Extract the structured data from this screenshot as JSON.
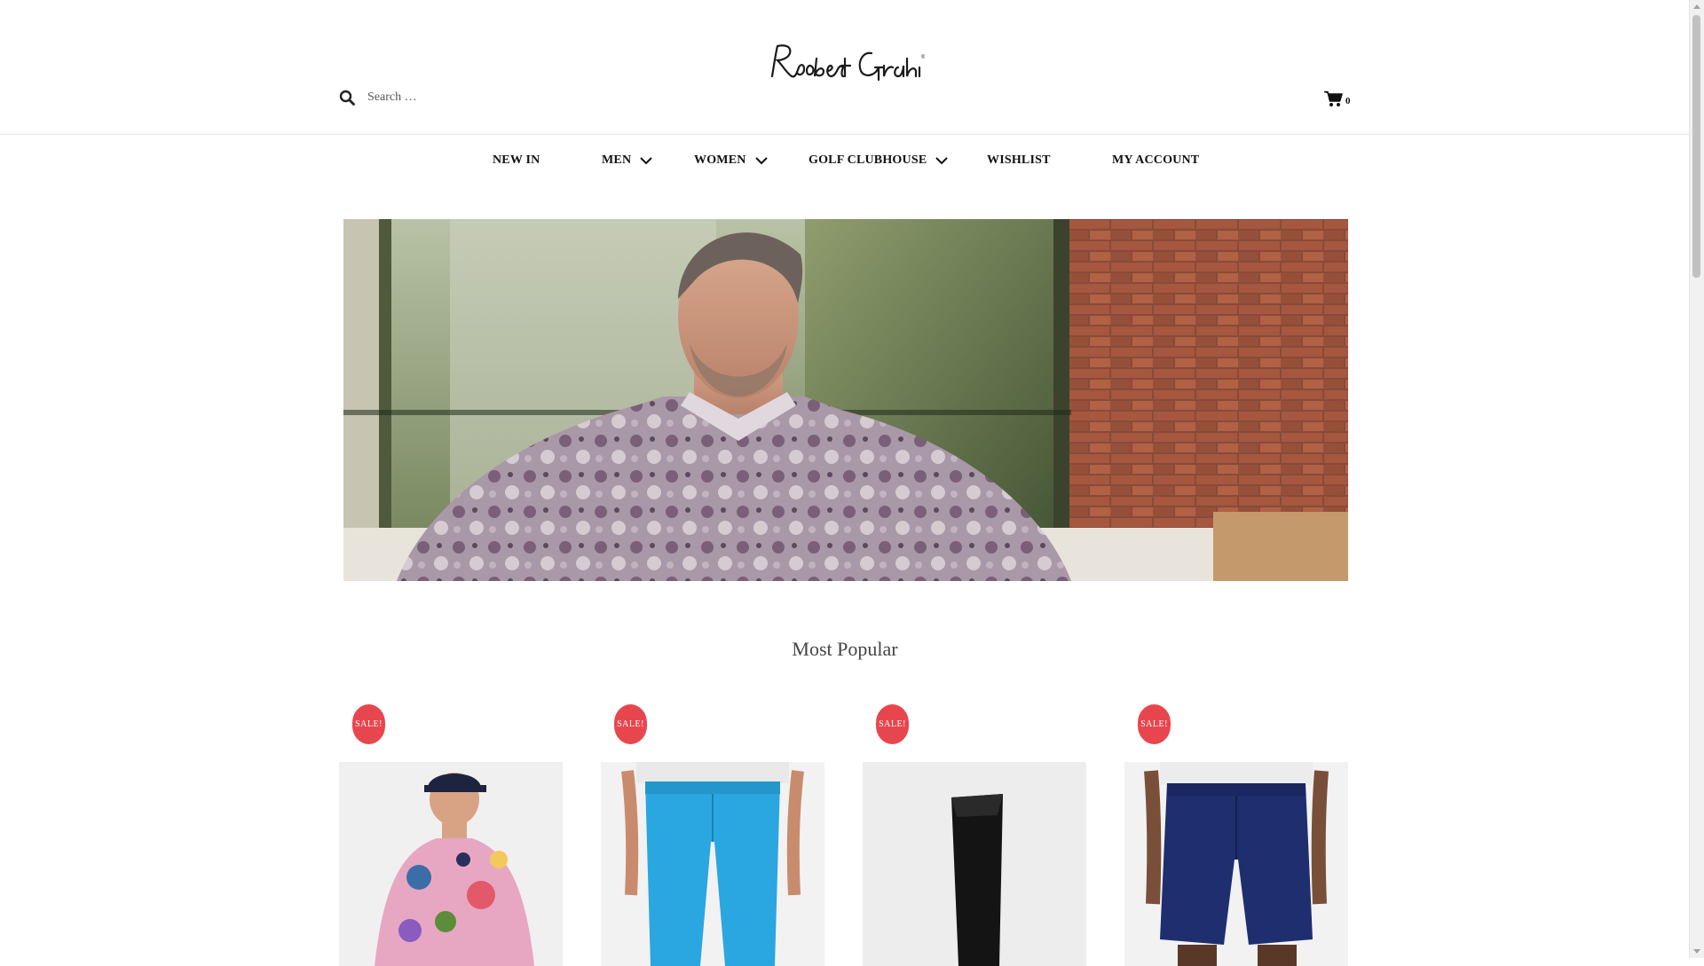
{
  "brand": {
    "logo_text": "Robert Graham"
  },
  "search": {
    "placeholder": "Search …"
  },
  "cart": {
    "count": "0"
  },
  "nav": {
    "items": [
      {
        "label": "NEW IN",
        "dropdown": false
      },
      {
        "label": "MEN",
        "dropdown": true
      },
      {
        "label": "WOMEN",
        "dropdown": true
      },
      {
        "label": "GOLF CLUBHOUSE",
        "dropdown": true
      },
      {
        "label": "WISHLIST",
        "dropdown": false
      },
      {
        "label": "MY ACCOUNT",
        "dropdown": false
      }
    ]
  },
  "section": {
    "title": "Most Popular"
  },
  "products": [
    {
      "badge": "SALE!",
      "image": "floral-polo-with-cap"
    },
    {
      "badge": "SALE!",
      "image": "sky-blue-pants"
    },
    {
      "badge": "SALE!",
      "image": "black-tie"
    },
    {
      "badge": "SALE!",
      "image": "navy-shorts"
    }
  ],
  "colors": {
    "sale_badge": "#e8464e",
    "nav_text": "#111111",
    "divider": "#e6e6e6"
  }
}
